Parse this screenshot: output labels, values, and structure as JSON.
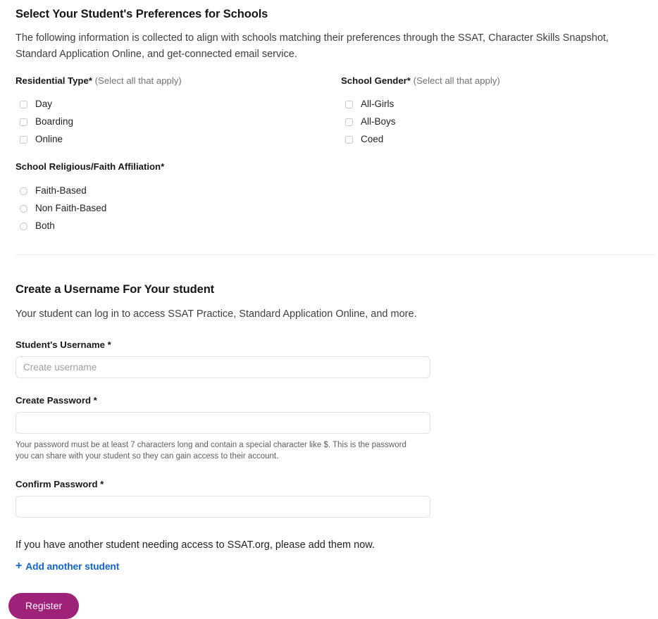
{
  "preferences": {
    "heading": "Select Your Student's Preferences for Schools",
    "description": "The following information is collected to align with schools matching their preferences through the SSAT, Character Skills Snapshot, Standard Application Online, and get-connected email service.",
    "residential": {
      "label": "Residential Type",
      "required_mark": "*",
      "hint": "(Select all that apply)",
      "options": [
        {
          "label": "Day"
        },
        {
          "label": "Boarding"
        },
        {
          "label": "Online"
        }
      ]
    },
    "school_gender": {
      "label": "School Gender",
      "required_mark": "*",
      "hint": "(Select all that apply)",
      "options": [
        {
          "label": "All-Girls"
        },
        {
          "label": "All-Boys"
        },
        {
          "label": "Coed"
        }
      ]
    },
    "faith": {
      "label": "School Religious/Faith Affiliation",
      "required_mark": "*",
      "hint": "",
      "options": [
        {
          "label": "Faith-Based"
        },
        {
          "label": "Non Faith-Based"
        },
        {
          "label": "Both"
        }
      ]
    }
  },
  "username_section": {
    "heading": "Create a Username For Your student",
    "description": "Your student can log in to access SSAT Practice, Standard Application Online, and more.",
    "fields": {
      "username": {
        "label": "Student's Username *",
        "value": "",
        "placeholder": "Create username"
      },
      "password": {
        "label": "Create Password *",
        "value": "",
        "placeholder": "",
        "helper": "Your password must be at least 7 characters long and contain a special character like $. This is the password you can share with your student so they can gain access to their account."
      },
      "confirm_password": {
        "label": "Confirm Password *",
        "value": "",
        "placeholder": ""
      }
    },
    "another_student_text": "If you have another student needing access to SSAT.org, please add them now.",
    "add_link": {
      "icon": "plus-icon",
      "glyph": "+",
      "label": "Add another student"
    },
    "submit": {
      "label": "Register"
    }
  },
  "colors": {
    "link_blue": "#1565c8",
    "register_magenta": "#9d2278",
    "border_gray": "#dfe1e5",
    "divider_gray": "#e9eaec",
    "hint_gray": "#6f747b"
  }
}
